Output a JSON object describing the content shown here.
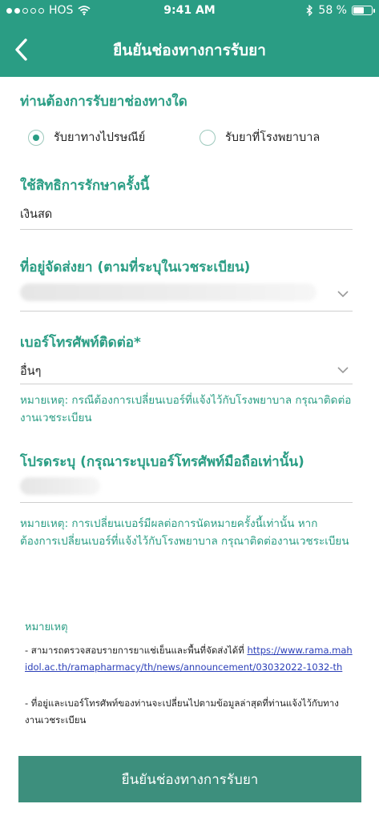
{
  "status_bar": {
    "carrier": "HOS",
    "time": "9:41 AM",
    "battery_label": "58 %",
    "battery_level_percent": 58,
    "signal_bars_filled": 2,
    "signal_bars_total": 5
  },
  "header": {
    "title": "ยืนยันช่องทางการรับยา",
    "back_icon": "chevron-left-icon"
  },
  "pickup": {
    "title": "ท่านต้องการรับยาช่องทางใด",
    "options": [
      {
        "label": "รับยาทางไปรษณีย์",
        "selected": true
      },
      {
        "label": "รับยาที่โรงพยาบาล",
        "selected": false
      }
    ]
  },
  "coverage": {
    "title": "ใช้สิทธิการรักษาครั้งนี้",
    "value": "เงินสด"
  },
  "address": {
    "title": "ที่อยู่จัดส่งยา (ตามที่ระบุในเวชระเบียน)"
  },
  "phone": {
    "title": "เบอร์โทรศัพท์ติดต่อ*",
    "value": "อื่นๆ",
    "note": "หมายเหตุ: กรณีต้องการเปลี่ยนเบอร์ที่แจ้งไว้กับโรงพยาบาล กรุณาติดต่องานเวชระเบียน"
  },
  "mobile": {
    "title": "โปรดระบุ (กรุณาระบุเบอร์โทรศัพท์มือถือเท่านั้น)",
    "note": "หมายเหตุ: การเปลี่ยนเบอร์มีผลต่อการนัดหมายครั้งนี้เท่านั้น หากต้องการเปลี่ยนเบอร์ที่แจ้งไว้กับโรงพยาบาล กรุณาติดต่องานเวชระเบียน"
  },
  "footer_note": {
    "title": "หมายเหตุ",
    "line1_prefix": "- สามารถตรวจสอบรายการยาแช่เย็นและพื้นที่จัดส่งได้ที่ ",
    "link": "https://www.rama.mahidol.ac.th/ramapharmacy/th/news/announcement/03032022-1032-th",
    "line2": "- ที่อยู่และเบอร์โทรศัพท์ของท่านจะเปลี่ยนไปตามข้อมูลล่าสุดที่ท่านแจ้งไว้กับทางงานเวชระเบียน"
  },
  "confirm_button": {
    "label": "ยืนยันช่องทางการรับยา"
  },
  "colors": {
    "brand": "#2a9d84",
    "button": "#3d8f7d",
    "link": "#2b3fb8"
  }
}
